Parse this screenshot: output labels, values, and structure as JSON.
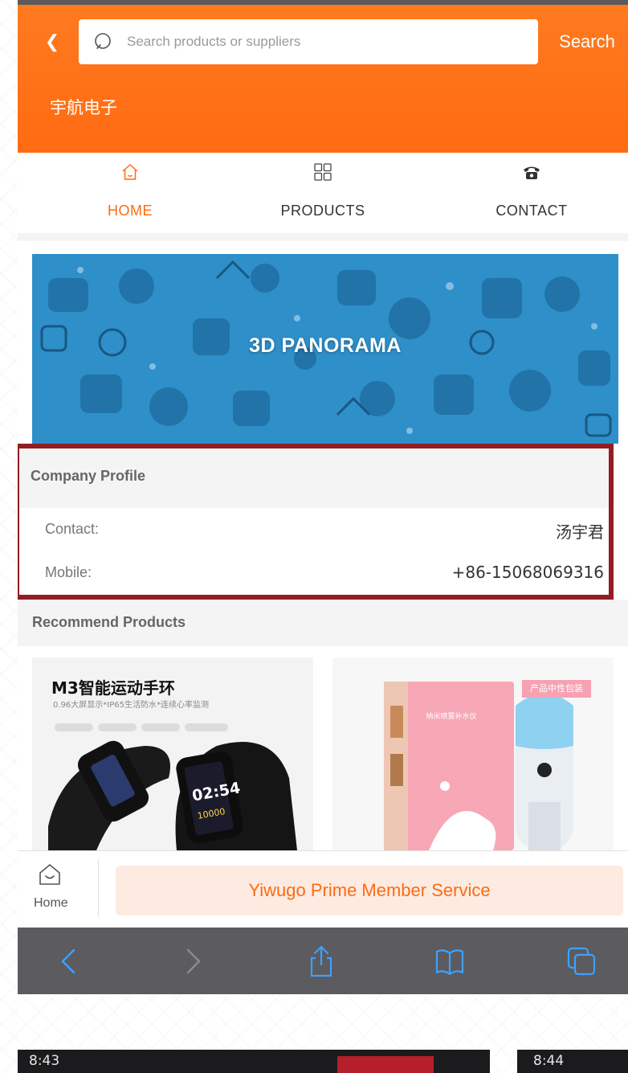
{
  "header": {
    "search_placeholder": "Search products or suppliers",
    "search_button": "Search",
    "shop_name": "宇航电子"
  },
  "nav": {
    "tabs": [
      {
        "label": "HOME",
        "icon": "home-icon",
        "active": true
      },
      {
        "label": "PRODUCTS",
        "icon": "grid-icon",
        "active": false
      },
      {
        "label": "CONTACT",
        "icon": "phone-icon",
        "active": false
      }
    ]
  },
  "banner": {
    "title": "3D PANORAMA"
  },
  "profile": {
    "title": "Company Profile",
    "rows": [
      {
        "label": "Contact:",
        "value": "汤宇君"
      },
      {
        "label": "Mobile:",
        "value": "+86-15068069316"
      }
    ]
  },
  "recommend": {
    "title": "Recommend Products",
    "products": [
      {
        "title": "M3智能运动手环",
        "subtitle": "0.96大屏显示*IP65生活防水*连续心率监测",
        "watch_time": "02:54",
        "watch_steps": "10000"
      },
      {
        "tag": "产品中性包装",
        "box_text": "纳米喷雾补水仪"
      }
    ]
  },
  "bottom_bar": {
    "home_label": "Home",
    "prime_label": "Yiwugo Prime Member Service"
  },
  "colors": {
    "accent": "#ff6a12",
    "banner": "#2e8fc9",
    "highlight_frame": "#931d22",
    "toolbar": "#5b5b60"
  },
  "fragments": {
    "time_left": "8:43",
    "time_right": "8:44"
  }
}
